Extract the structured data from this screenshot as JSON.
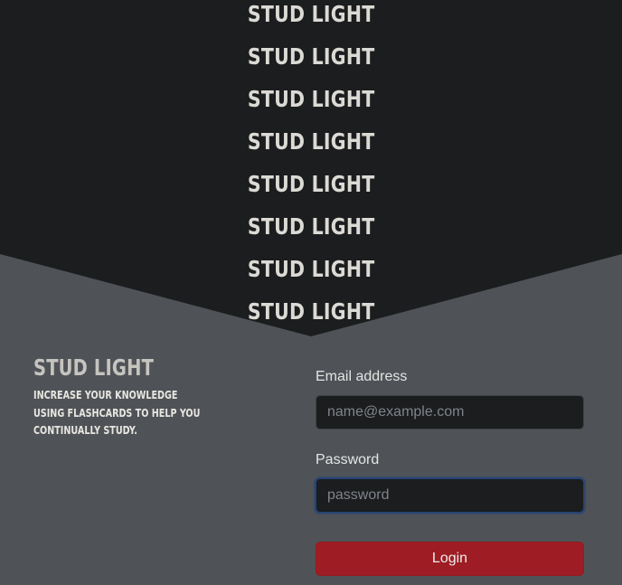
{
  "hero": {
    "title_lines": [
      "Stud Light",
      "Stud Light",
      "Stud Light",
      "Stud Light",
      "Stud Light",
      "Stud Light",
      "Stud Light",
      "Stud Light"
    ]
  },
  "brand": {
    "title": "Stud Light",
    "tagline": "Increase your knowledge using flashcards to help you continually study."
  },
  "login": {
    "email_label": "Email address",
    "email_placeholder": "name@example.com",
    "email_value": "",
    "password_label": "Password",
    "password_placeholder": "password",
    "password_value": "",
    "submit_label": "Login"
  },
  "colors": {
    "page_background": "#4f5357",
    "hero_background": "#1c1d1f",
    "title_text": "#dcdad5",
    "input_background": "#1c1d1f",
    "focus_ring": "#1d3f7a",
    "login_button": "#9e1c23"
  }
}
